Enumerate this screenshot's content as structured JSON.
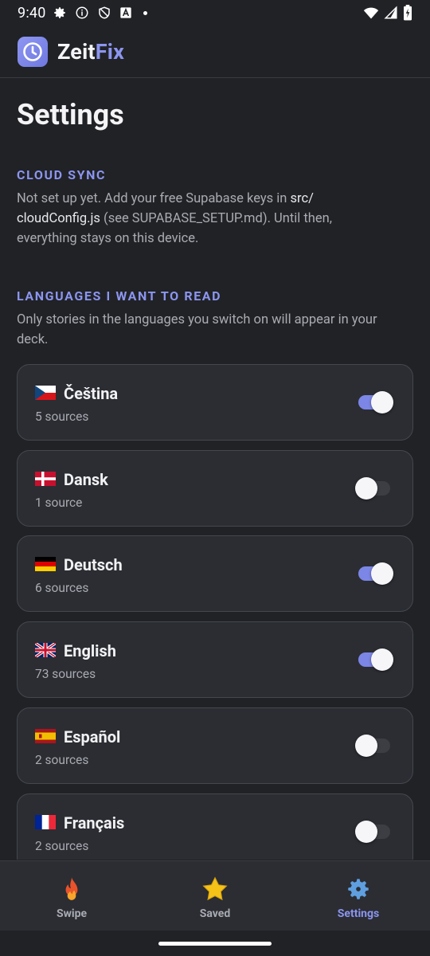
{
  "status_bar": {
    "time": "9:40",
    "icons": [
      "gear-icon",
      "info-icon",
      "shield-icon",
      "a-icon",
      "dot-icon",
      "wifi-icon",
      "signal-icon",
      "battery-icon"
    ]
  },
  "app": {
    "brand_part1": "Zeit",
    "brand_part2": "Fix",
    "brand_color": "#8c95ef"
  },
  "page": {
    "title": "Settings"
  },
  "cloud_sync": {
    "heading": "CLOUD SYNC",
    "text_before": "Not set up yet. Add your free Supabase keys in ",
    "code_file": "src/ cloudConfig.js",
    "text_after": " (see SUPABASE_SETUP.md). Until then, everything stays on this device."
  },
  "languages": {
    "heading": "LANGUAGES I WANT TO READ",
    "description": "Only stories in the languages you switch on will appear in your deck.",
    "items": [
      {
        "name": "Čeština",
        "sources": "5 sources",
        "enabled": true,
        "flag": "cz"
      },
      {
        "name": "Dansk",
        "sources": "1 source",
        "enabled": false,
        "flag": "dk"
      },
      {
        "name": "Deutsch",
        "sources": "6 sources",
        "enabled": true,
        "flag": "de"
      },
      {
        "name": "English",
        "sources": "73 sources",
        "enabled": true,
        "flag": "gb"
      },
      {
        "name": "Español",
        "sources": "2 sources",
        "enabled": false,
        "flag": "es"
      },
      {
        "name": "Français",
        "sources": "2 sources",
        "enabled": false,
        "flag": "fr"
      }
    ]
  },
  "bottom_nav": {
    "items": [
      {
        "label": "Swipe",
        "icon": "fire-icon",
        "active": false
      },
      {
        "label": "Saved",
        "icon": "star-icon",
        "active": false
      },
      {
        "label": "Settings",
        "icon": "gear-icon",
        "active": true
      }
    ]
  },
  "colors": {
    "background": "#202226",
    "card": "#2b2d33",
    "accent": "#8c95ef",
    "toggle_on": "#7c86e6"
  }
}
